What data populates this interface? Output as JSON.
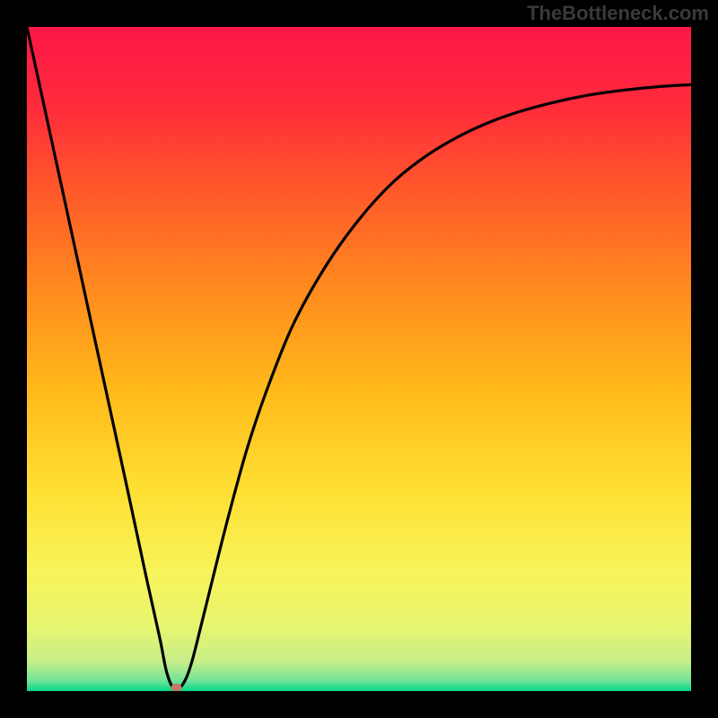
{
  "watermark": "TheBottleneck.com",
  "chart_data": {
    "type": "line",
    "title": "",
    "xlabel": "",
    "ylabel": "",
    "xlim": [
      0,
      100
    ],
    "ylim": [
      0,
      100
    ],
    "gradient_stops": [
      {
        "offset": 0.0,
        "color": "#ff1747"
      },
      {
        "offset": 0.12,
        "color": "#ff2b3b"
      },
      {
        "offset": 0.25,
        "color": "#ff5a2a"
      },
      {
        "offset": 0.4,
        "color": "#ff8c1e"
      },
      {
        "offset": 0.55,
        "color": "#ffba1a"
      },
      {
        "offset": 0.7,
        "color": "#ffe033"
      },
      {
        "offset": 0.82,
        "color": "#f7f35a"
      },
      {
        "offset": 0.9,
        "color": "#e8f56f"
      },
      {
        "offset": 0.955,
        "color": "#c8ee88"
      },
      {
        "offset": 0.985,
        "color": "#6fe39a"
      },
      {
        "offset": 1.0,
        "color": "#00d886"
      }
    ],
    "series": [
      {
        "name": "curve",
        "x": [
          0,
          5,
          10,
          15,
          18,
          20,
          21,
          22,
          23,
          24,
          25,
          27,
          30,
          33,
          36,
          40,
          45,
          50,
          55,
          60,
          65,
          70,
          75,
          80,
          85,
          90,
          95,
          100
        ],
        "y": [
          100,
          77,
          54,
          31,
          17,
          8,
          3,
          0.5,
          0.5,
          2,
          5,
          13,
          25,
          36,
          45,
          55,
          64,
          71,
          76.5,
          80.5,
          83.5,
          85.8,
          87.5,
          88.8,
          89.8,
          90.5,
          91.0,
          91.3
        ]
      }
    ],
    "marker": {
      "x": 22.5,
      "y": 0.5,
      "color": "#c4786a",
      "radius_px": 6
    }
  }
}
